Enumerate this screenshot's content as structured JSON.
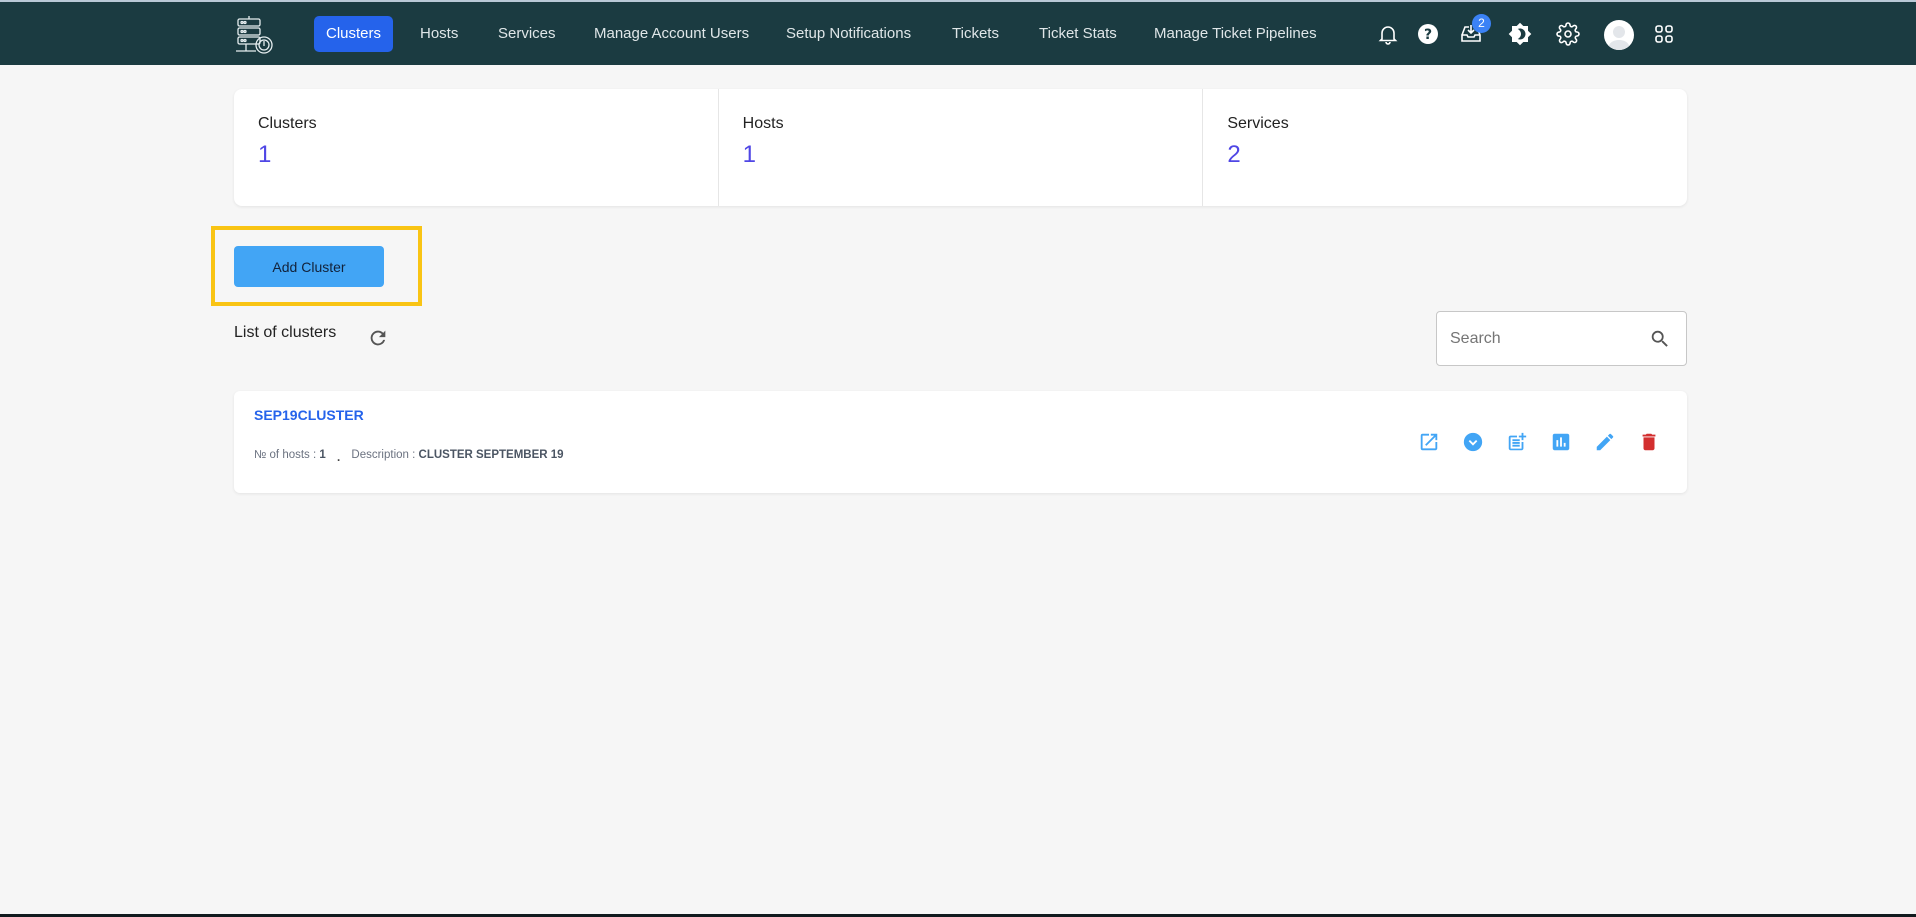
{
  "nav": {
    "items": [
      {
        "label": "Clusters",
        "active": true
      },
      {
        "label": "Hosts"
      },
      {
        "label": "Services"
      },
      {
        "label": "Manage Account Users"
      },
      {
        "label": "Setup Notifications"
      },
      {
        "label": "Tickets"
      },
      {
        "label": "Ticket Stats"
      },
      {
        "label": "Manage Ticket Pipelines"
      }
    ],
    "icons": [
      "bell-icon",
      "help-icon",
      "inbox-icon",
      "theme-toggle-icon",
      "settings-icon",
      "avatar",
      "apps-grid-icon"
    ],
    "inbox_badge": "2"
  },
  "stats": [
    {
      "label": "Clusters",
      "value": "1"
    },
    {
      "label": "Hosts",
      "value": "1"
    },
    {
      "label": "Services",
      "value": "2"
    }
  ],
  "actions": {
    "add_cluster": "Add Cluster"
  },
  "list": {
    "title": "List of clusters",
    "search_placeholder": "Search",
    "search_value": ""
  },
  "clusters": [
    {
      "name": "SEP19CLUSTER",
      "hosts_label": "№ of hosts : ",
      "hosts": "1",
      "separator": ".",
      "description_label": "Description : ",
      "description": "CLUSTER SEPTEMBER 19",
      "actions": [
        "open-external-icon",
        "expand-icon",
        "add-note-icon",
        "stats-chart-icon",
        "edit-icon",
        "delete-icon"
      ]
    }
  ],
  "colors": {
    "navbar_bg": "#1b3b41",
    "active_nav": "#2563eb",
    "add_button": "#42a5f5",
    "highlight_outline": "#f9c414",
    "stat_value": "#4f46e5",
    "action_icon": "#42a5f5",
    "delete_icon": "#d32f2f"
  }
}
